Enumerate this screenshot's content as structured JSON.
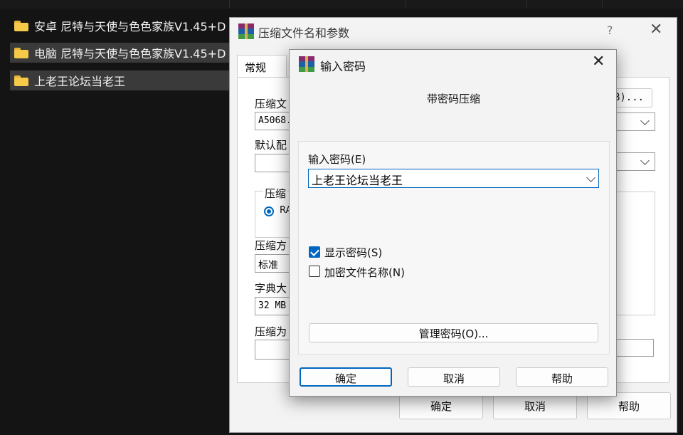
{
  "explorer": {
    "files": [
      {
        "name": "安卓 尼特与天使与色色家族V1.45+D"
      },
      {
        "name": "电脑 尼特与天使与色色家族V1.45+D"
      },
      {
        "name": "上老王论坛当老王"
      }
    ]
  },
  "back_dialog": {
    "title": "压缩文件名和参数",
    "help_glyph": "?",
    "close_glyph": "✕",
    "tab_general": "常规",
    "archive_name_label": "压缩文",
    "archive_name_value": "A5068.",
    "browse_button": "B)...",
    "default_profile_label": "默认配",
    "format_group_label": "压缩",
    "format_rar_label": "RA",
    "method_label": "压缩方",
    "method_value": "标准",
    "dict_label": "字典大",
    "dict_value": "32 MB",
    "split_label": "压缩为",
    "ok_button": "确定",
    "cancel_button": "取消",
    "help_button": "帮助"
  },
  "password_dialog": {
    "title": "输入密码",
    "close_glyph": "✕",
    "heading": "带密码压缩",
    "password_label": "输入密码(E)",
    "password_value": "上老王论坛当老王",
    "show_password_label": "显示密码(S)",
    "show_password_checked": true,
    "encrypt_names_label": "加密文件名称(N)",
    "encrypt_names_checked": false,
    "manage_button": "管理密码(O)...",
    "ok_button": "确定",
    "cancel_button": "取消",
    "help_button": "帮助"
  },
  "colors": {
    "accent": "#0067c0",
    "explorer_bg": "#141414",
    "folder": "#f7c948"
  }
}
